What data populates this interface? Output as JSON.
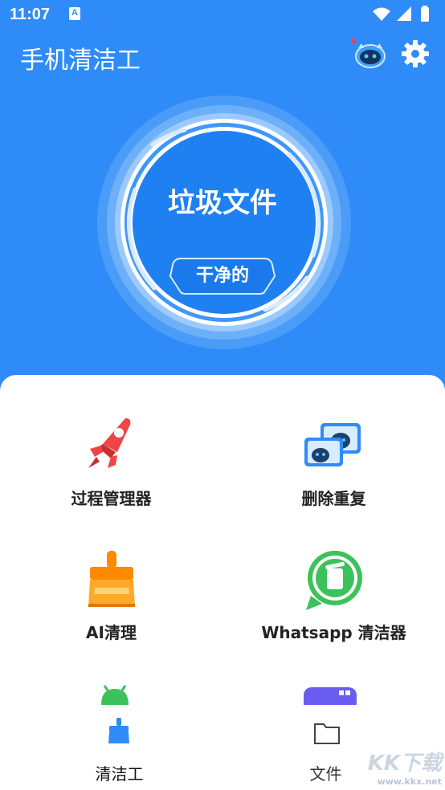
{
  "status_bar": {
    "time": "11:07",
    "notification_glyph": "A"
  },
  "app_bar": {
    "title": "手机清洁工"
  },
  "hero": {
    "title": "垃圾文件",
    "status": "干净的"
  },
  "tiles": [
    {
      "label": "过程管理器",
      "icon": "rocket-icon"
    },
    {
      "label": "删除重复",
      "icon": "duplicate-images-icon"
    },
    {
      "label": "AI清理",
      "icon": "broom-icon"
    },
    {
      "label": "Whatsapp 清洁器",
      "icon": "whatsapp-trash-icon"
    }
  ],
  "bottom_nav": [
    {
      "label": "清洁工",
      "icon": "cleaner-icon",
      "active": true
    },
    {
      "label": "文件",
      "icon": "folder-icon",
      "active": false
    }
  ],
  "watermark": {
    "brand": "KK下载",
    "url": "www.kkx.net"
  },
  "colors": {
    "primary": "#2f8bf7",
    "circle_fill": "#2b86f2",
    "accent_orange": "#ff8a00",
    "whatsapp_green": "#3cc25a"
  }
}
